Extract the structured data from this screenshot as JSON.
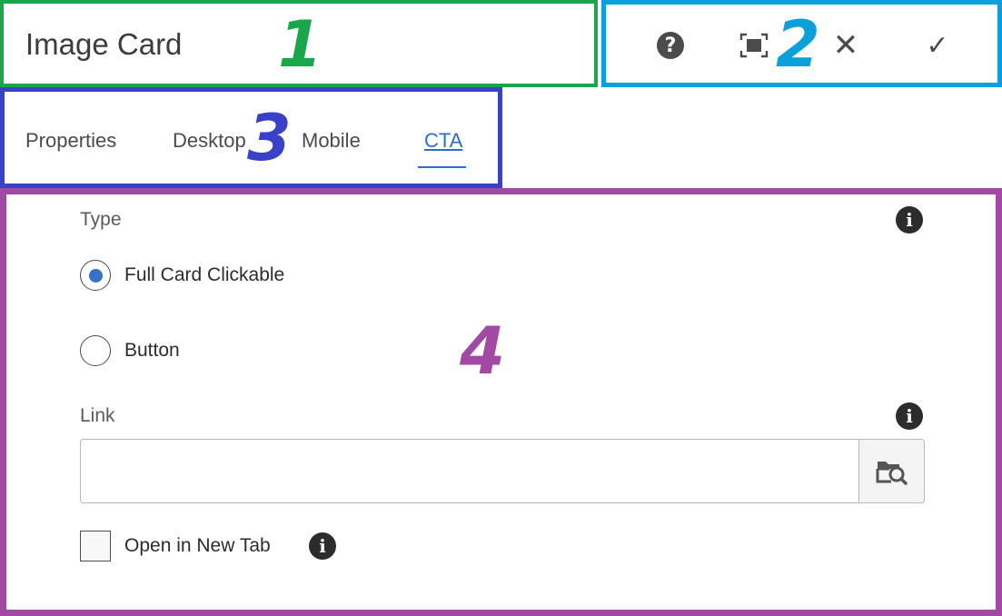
{
  "annotations": {
    "m1": "1",
    "m2": "2",
    "m3": "3",
    "m4": "4"
  },
  "colors": {
    "green": "#1aa64a",
    "cyan": "#0aa0dc",
    "blue": "#3a40c8",
    "purple": "#a249a4",
    "accent": "#2d6ecb"
  },
  "header": {
    "title": "Image Card",
    "actions": [
      {
        "name": "help",
        "icon": "question-circle-icon"
      },
      {
        "name": "fullscreen",
        "icon": "fullscreen-icon"
      },
      {
        "name": "close",
        "icon": "close-icon",
        "glyph": "✕"
      },
      {
        "name": "done",
        "icon": "checkmark-icon",
        "glyph": "✓"
      }
    ]
  },
  "tabs": {
    "items": [
      "Properties",
      "Desktop",
      "Mobile",
      "CTA"
    ],
    "active": "CTA"
  },
  "panel": {
    "type": {
      "label": "Type",
      "options": [
        "Full Card Clickable",
        "Button"
      ],
      "selected": "Full Card Clickable"
    },
    "link": {
      "label": "Link",
      "value": "",
      "placeholder": ""
    },
    "new_tab": {
      "label": "Open in New Tab",
      "checked": false
    }
  }
}
